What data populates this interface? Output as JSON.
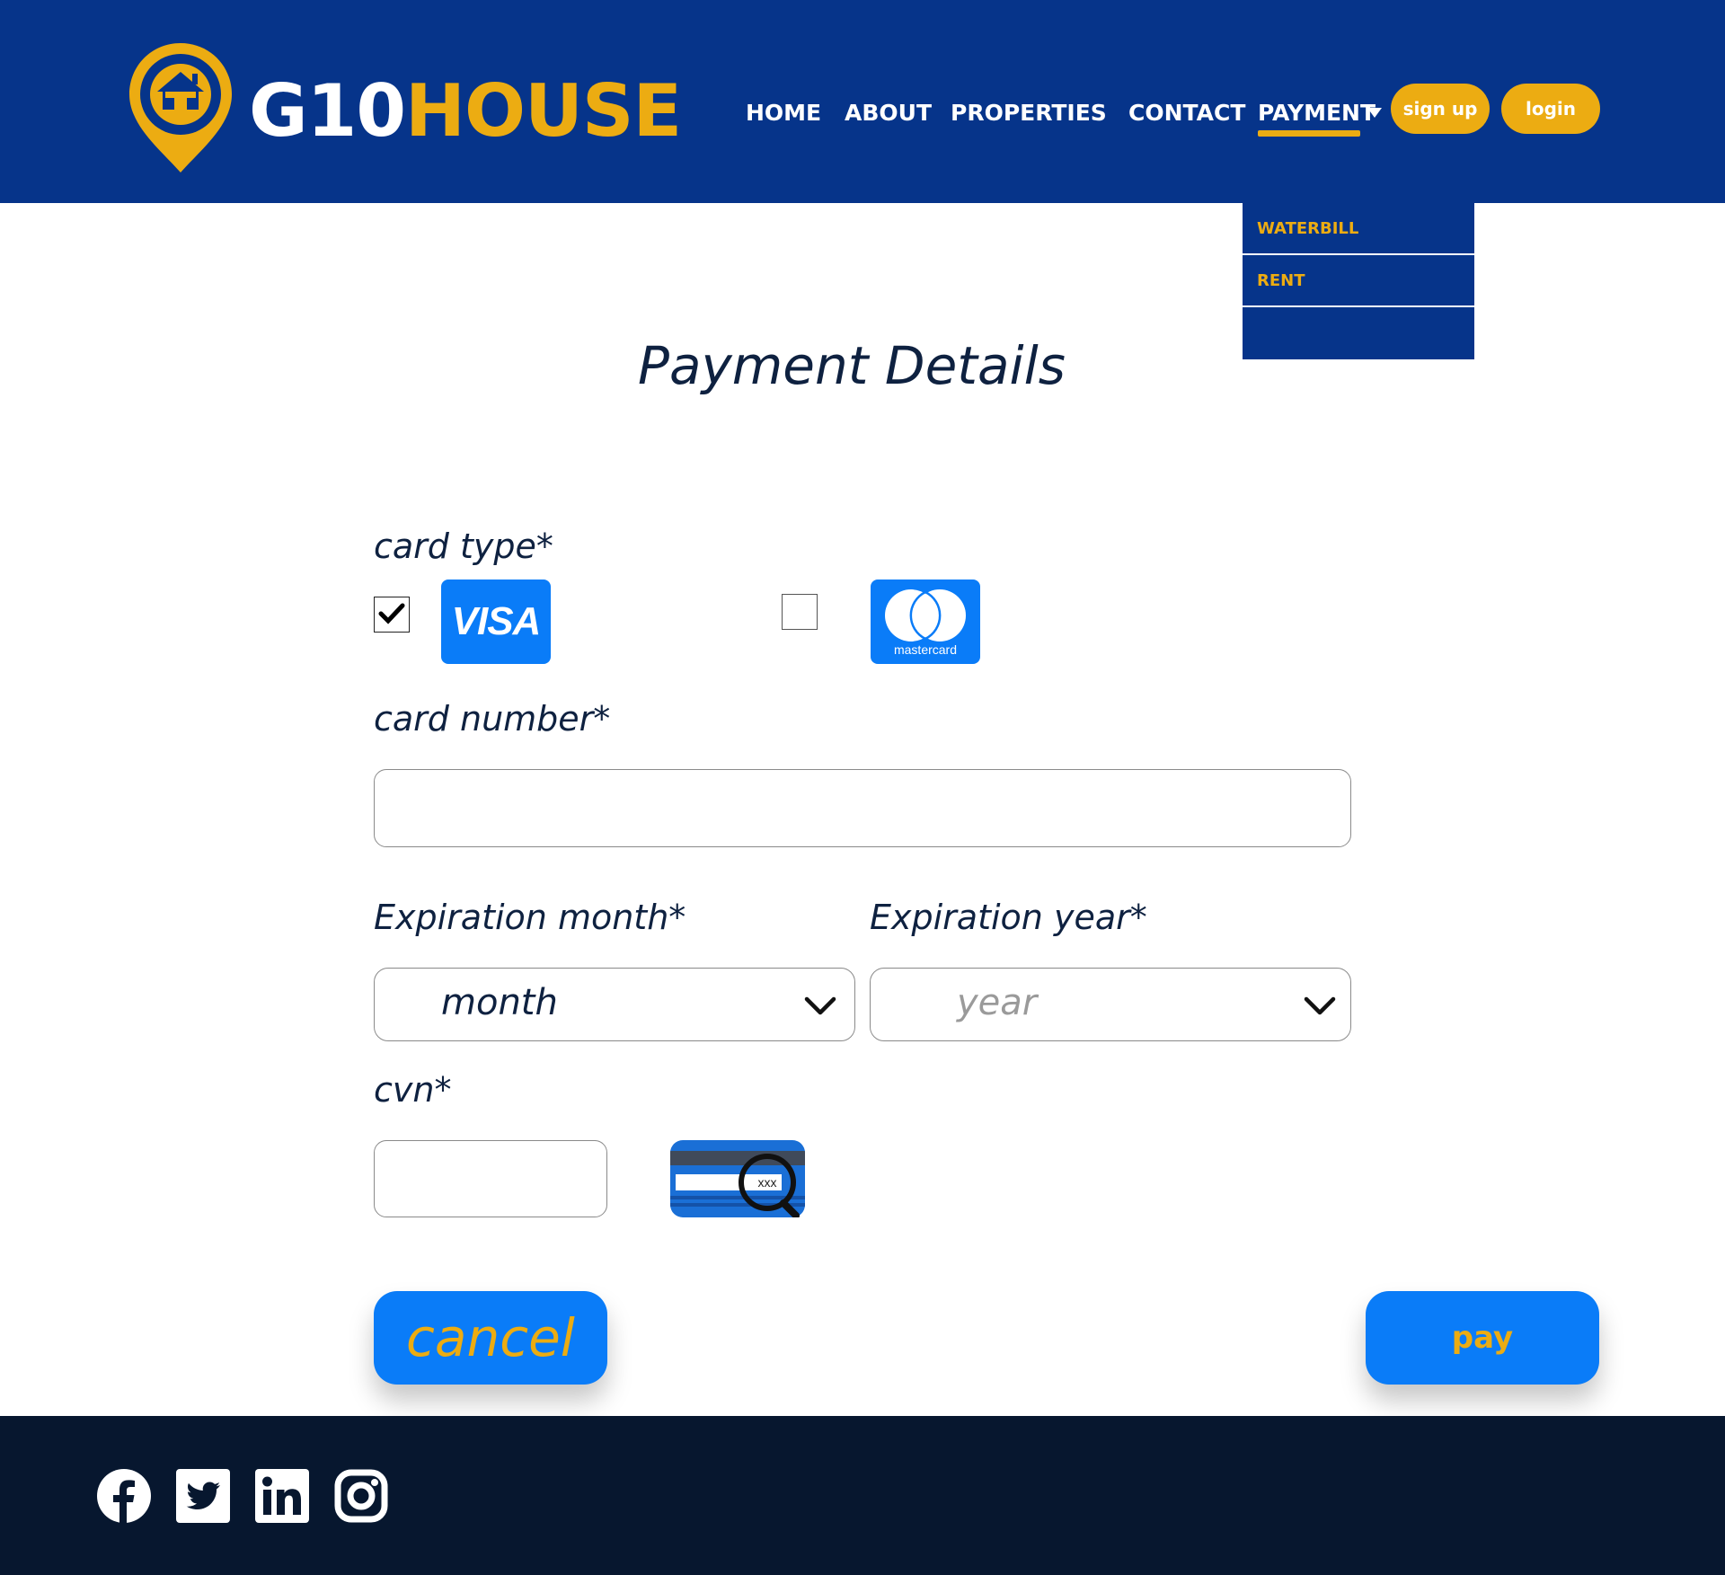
{
  "brand": {
    "part1": "G10",
    "part2": "HOUSE"
  },
  "nav": {
    "home": "HOME",
    "about": "ABOUT",
    "properties": "PROPERTIES",
    "contact": "CONTACT",
    "payment": "PAYMENT",
    "active": "PAYMENT",
    "signup": "sign up",
    "login": "login"
  },
  "payment_menu": {
    "items": [
      "WATERBILL",
      "RENT",
      ""
    ]
  },
  "form": {
    "title": "Payment Details",
    "card_type_label": "card type*",
    "visa_checked": true,
    "mastercard_checked": false,
    "visa_logo_text": "VISA",
    "mastercard_logo_text": "mastercard",
    "card_number_label": "card number*",
    "card_number_value": "",
    "exp_month_label": "Expiration month*",
    "exp_month_value": "month",
    "exp_year_label": "Expiration year*",
    "exp_year_placeholder": "year",
    "cvn_label": "cvn*",
    "cvn_value": "",
    "cvn_hint_text": "xxx",
    "cancel_label": "cancel",
    "pay_label": "pay"
  },
  "colors": {
    "header_bg": "#06348a",
    "accent_gold": "#ecac12",
    "button_blue": "#0a7cf8",
    "text_dark": "#0e2140",
    "footer_bg": "#07172f"
  },
  "footer": {
    "social_icons": [
      "facebook-icon",
      "twitter-icon",
      "linkedin-icon",
      "instagram-icon"
    ]
  }
}
